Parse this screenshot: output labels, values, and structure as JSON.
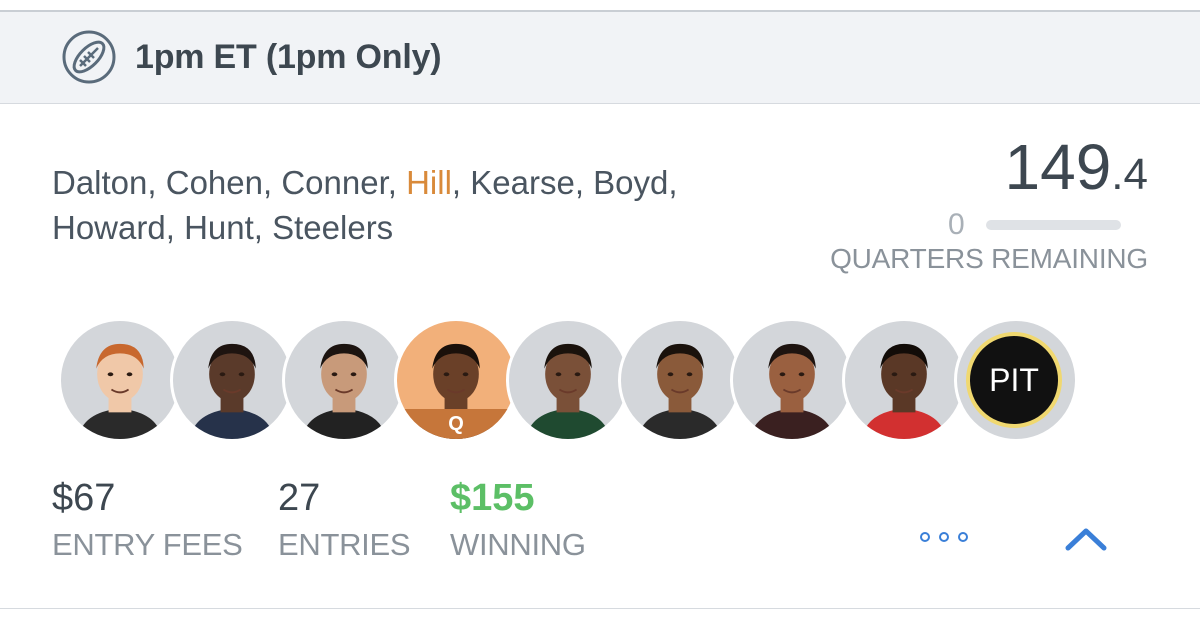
{
  "header": {
    "title": "1pm ET (1pm Only)",
    "icon": "football-icon"
  },
  "lineup": {
    "names": [
      "Dalton",
      "Cohen",
      "Conner",
      "Hill",
      "Kearse",
      "Boyd",
      "Howard",
      "Hunt",
      "Steelers"
    ],
    "highlighted_name": "Hill",
    "highlight_color": "#d98a3a"
  },
  "score": {
    "integer": "149",
    "decimal": ".4"
  },
  "quarters_remaining": {
    "value": "0",
    "label": "QUARTERS REMAINING",
    "progress": 0
  },
  "players": [
    {
      "name": "Dalton",
      "icon": "player-photo",
      "jersey": "#2a2a2a",
      "skin": "#f0c8a8",
      "hair": "#c8682e"
    },
    {
      "name": "Cohen",
      "icon": "player-photo",
      "jersey": "#26324a",
      "skin": "#5a3a2a",
      "hair": "#1e1410"
    },
    {
      "name": "Conner",
      "icon": "player-photo",
      "jersey": "#222222",
      "skin": "#c89a7a",
      "hair": "#1c1410"
    },
    {
      "name": "Hill",
      "icon": "player-photo",
      "jersey": "#4a2a1a",
      "skin": "#6a4028",
      "hair": "#1a100a",
      "badge": "Q"
    },
    {
      "name": "Kearse",
      "icon": "player-photo",
      "jersey": "#1f4a30",
      "skin": "#7a5038",
      "hair": "#1a120c"
    },
    {
      "name": "Boyd",
      "icon": "player-photo",
      "jersey": "#2a2a2a",
      "skin": "#8a5a3a",
      "hair": "#1a120c"
    },
    {
      "name": "Howard",
      "icon": "player-photo",
      "jersey": "#3a2020",
      "skin": "#9a6040",
      "hair": "#1e1410"
    },
    {
      "name": "Hunt",
      "icon": "player-photo",
      "jersey": "#d23030",
      "skin": "#5a3826",
      "hair": "#120c08"
    }
  ],
  "team": {
    "abbr": "PIT",
    "ring_color": "#f0d870"
  },
  "stats": {
    "entry_fees": {
      "value": "$67",
      "label": "ENTRY FEES"
    },
    "entries": {
      "value": "27",
      "label": "ENTRIES"
    },
    "winning": {
      "value": "$155",
      "label": "WINNING",
      "color": "#5cbf66"
    }
  },
  "actions": {
    "more_icon": "more-dots-icon",
    "collapse_icon": "chevron-up-icon",
    "accent": "#3a7fd8"
  }
}
